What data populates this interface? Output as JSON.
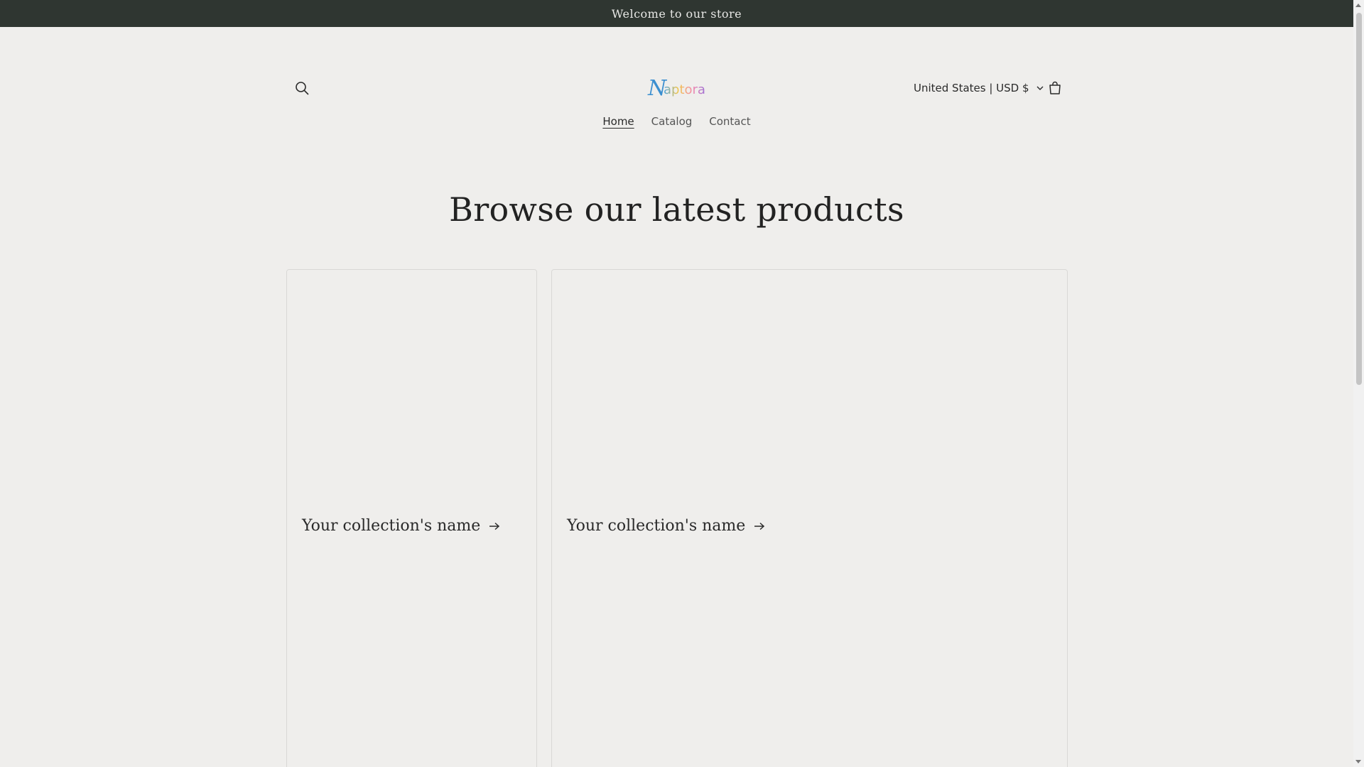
{
  "announcement": {
    "text": "Welcome to our store"
  },
  "header": {
    "logo_text": "Naptora",
    "search_icon": "search-icon",
    "cart_icon": "cart-icon",
    "country_selector": "United States | USD $"
  },
  "nav": {
    "items": [
      {
        "label": "Home",
        "active": true
      },
      {
        "label": "Catalog",
        "active": false
      },
      {
        "label": "Contact",
        "active": false
      }
    ]
  },
  "main": {
    "heading": "Browse our latest products",
    "collections": [
      {
        "title": "Your collection's name"
      },
      {
        "title": "Your collection's name"
      }
    ]
  },
  "colors": {
    "background": "#efeeec",
    "announcement_bg": "#2f3631",
    "text": "#222222"
  }
}
